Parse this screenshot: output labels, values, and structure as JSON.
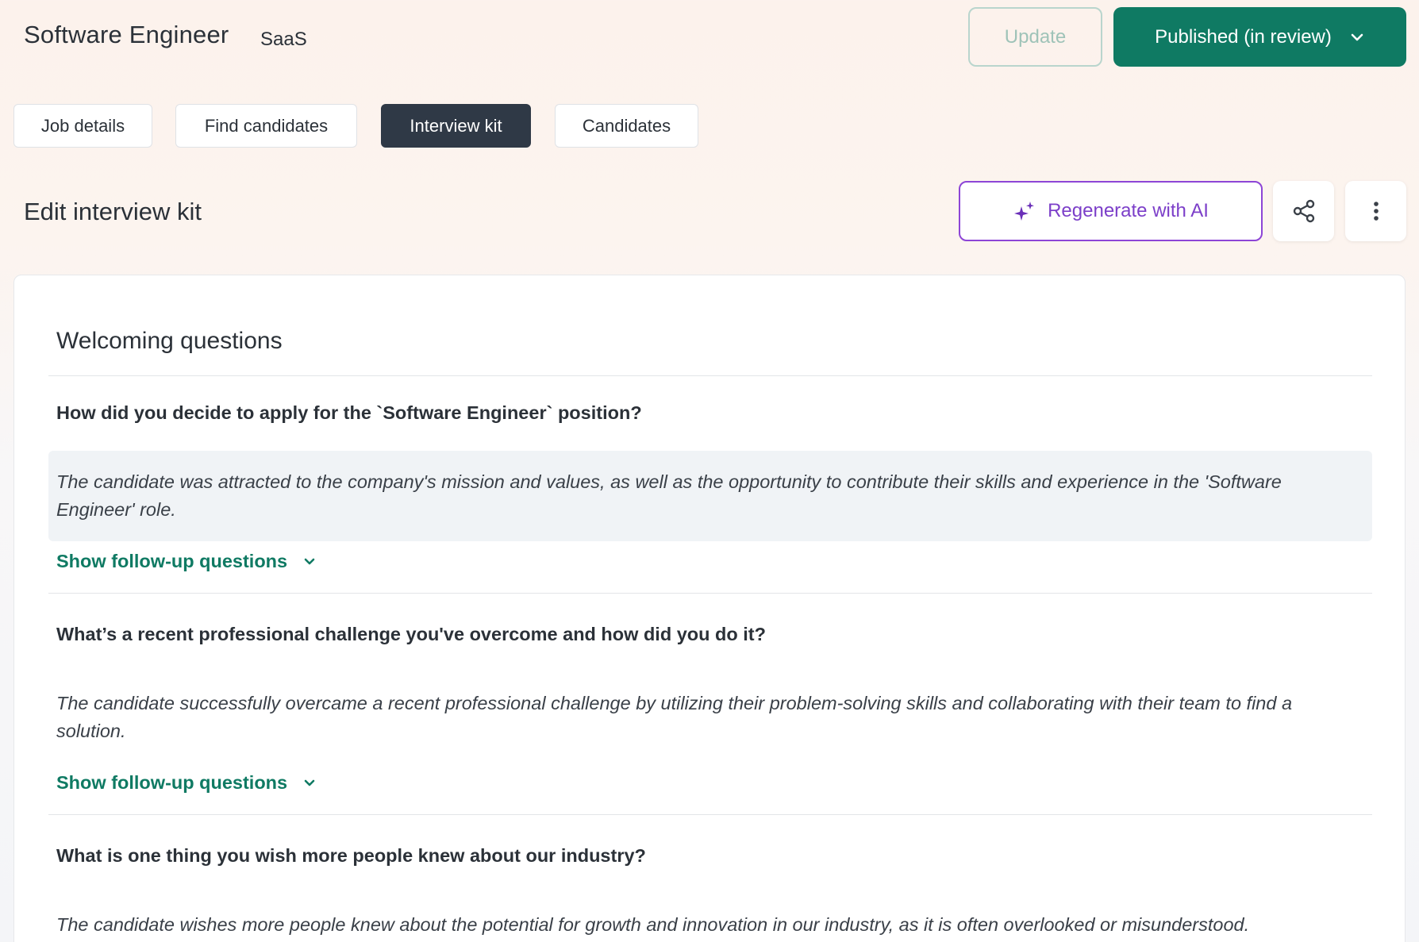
{
  "header": {
    "job_title": "Software Engineer",
    "job_category": "SaaS",
    "update_label": "Update",
    "published_label": "Published (in review)"
  },
  "tabs": [
    {
      "label": "Job details",
      "active": false
    },
    {
      "label": "Find candidates",
      "active": false
    },
    {
      "label": "Interview kit",
      "active": true
    },
    {
      "label": "Candidates",
      "active": false
    }
  ],
  "section": {
    "title": "Edit interview kit",
    "regenerate_label": "Regenerate with AI",
    "share_icon": "share-icon",
    "more_icon": "more-vertical-icon"
  },
  "card": {
    "title": "Welcoming questions",
    "questions": [
      {
        "question": "How did you decide to apply for the `Software Engineer` position?",
        "answer": "The candidate was attracted to the company's mission and values, as well as the opportunity to contribute their skills and experience in the 'Software Engineer' role.",
        "followup_label": "Show follow-up questions"
      },
      {
        "question": "What’s a recent professional challenge you've overcome and how did you do it?",
        "answer": "The candidate successfully overcame a recent professional challenge by utilizing their problem-solving skills and collaborating with their team to find a solution.",
        "followup_label": "Show follow-up questions"
      },
      {
        "question": "What is one thing you wish more people knew about our industry?",
        "answer": "The candidate wishes more people knew about the potential for growth and innovation in our industry, as it is often overlooked or misunderstood."
      }
    ]
  },
  "colors": {
    "brand_green": "#0f7a63",
    "ai_purple": "#7c3fc9",
    "active_tab": "#2f3946"
  }
}
